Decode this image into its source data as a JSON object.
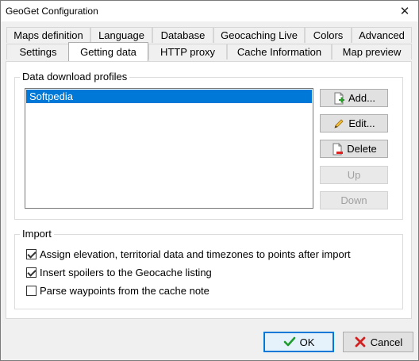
{
  "window": {
    "title": "GeoGet Configuration",
    "close_glyph": "✕"
  },
  "tabs": {
    "row1": [
      "Maps definition",
      "Language",
      "Database",
      "Geocaching Live",
      "Colors",
      "Advanced"
    ],
    "row2": [
      "Settings",
      "Getting data",
      "HTTP proxy",
      "Cache Information",
      "Map preview"
    ],
    "active": "Getting data"
  },
  "profiles": {
    "group_label": "Data download profiles",
    "items": [
      "Softpedia"
    ],
    "selected": "Softpedia",
    "buttons": {
      "add": "Add...",
      "edit": "Edit...",
      "delete": "Delete",
      "up": "Up",
      "down": "Down"
    }
  },
  "import": {
    "group_label": "Import",
    "options": [
      {
        "label": "Assign elevation, territorial data and timezones to points after import",
        "checked": true
      },
      {
        "label": "Insert spoilers to the Geocache listing",
        "checked": true
      },
      {
        "label": "Parse waypoints from the cache note",
        "checked": false
      }
    ]
  },
  "footer": {
    "ok_label": "OK",
    "cancel_label": "Cancel"
  },
  "icons": {
    "add": "document-add-icon",
    "edit": "pencil-icon",
    "delete": "document-delete-icon",
    "ok": "checkmark-icon",
    "cancel": "cross-icon"
  },
  "colors": {
    "selection": "#0078d7",
    "ok_check": "#1e9c2e",
    "cancel_cross": "#d21f1f"
  }
}
